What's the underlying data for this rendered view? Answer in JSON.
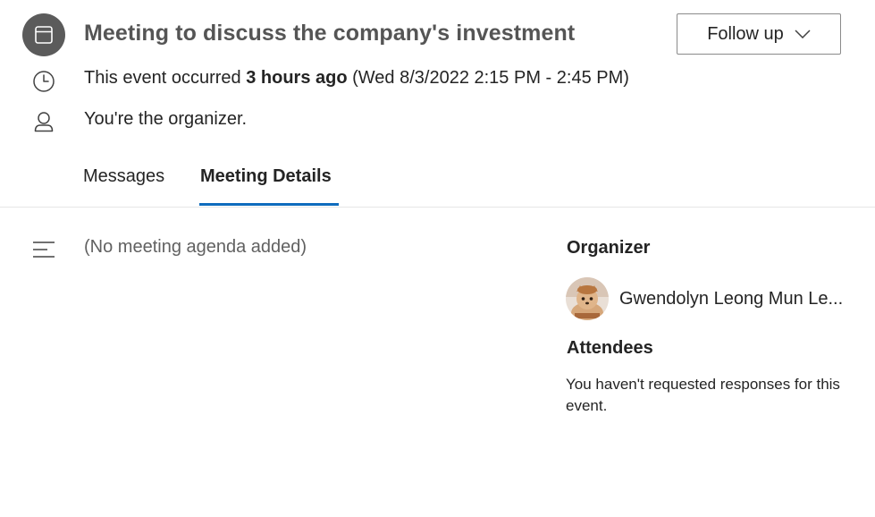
{
  "header": {
    "title": "Meeting to discuss the company's investment",
    "follow_up_label": "Follow up"
  },
  "event_time": {
    "prefix": "This event occurred ",
    "relative": "3 hours ago",
    "absolute": " (Wed 8/3/2022 2:15 PM - 2:45 PM)"
  },
  "organizer_note": "You're the organizer.",
  "tabs": [
    {
      "label": "Messages",
      "selected": false
    },
    {
      "label": "Meeting Details",
      "selected": true
    }
  ],
  "agenda": {
    "text": "(No meeting agenda added)"
  },
  "organizer_section": {
    "heading": "Organizer",
    "name": "Gwendolyn Leong Mun Le..."
  },
  "attendees_section": {
    "heading": "Attendees",
    "note": "You haven't requested responses for this event."
  },
  "icons": {
    "event": "calendar-icon",
    "time": "clock-icon",
    "organizer": "person-icon",
    "agenda": "text-align-left-icon",
    "follow_up": "chevron-down-icon"
  },
  "colors": {
    "accent": "#0f6cbd",
    "badge": "#5b5b5b",
    "title": "#555555"
  }
}
